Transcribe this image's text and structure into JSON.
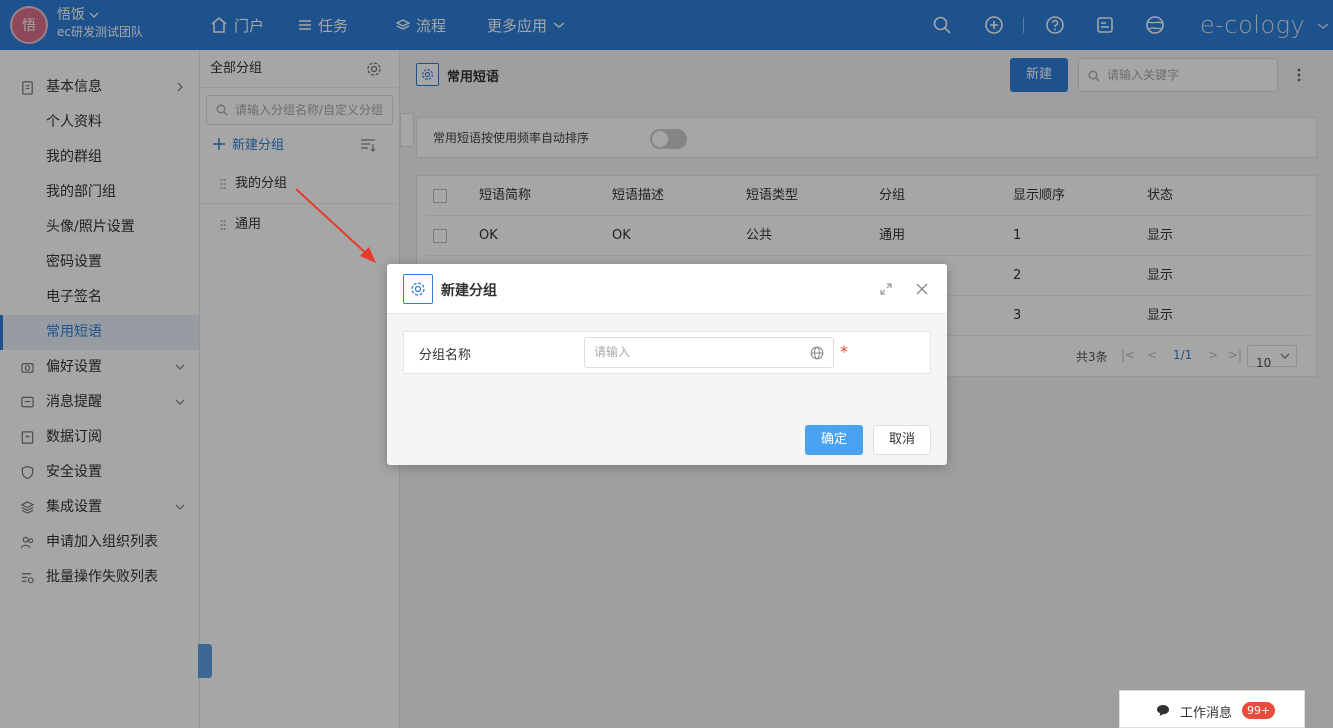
{
  "header": {
    "avatar_char": "悟",
    "user_name": "悟饭",
    "team": "ec研发测试团队",
    "nav": [
      "门户",
      "任务",
      "流程",
      "更多应用"
    ],
    "brand": "e-cology"
  },
  "sidebar": {
    "items": [
      {
        "label": "基本信息",
        "icon": "clipboard-icon",
        "arrow": "right"
      },
      {
        "label": "个人资料"
      },
      {
        "label": "我的群组"
      },
      {
        "label": "我的部门组"
      },
      {
        "label": "头像/照片设置"
      },
      {
        "label": "密码设置"
      },
      {
        "label": "电子签名"
      },
      {
        "label": "常用短语",
        "active": true
      },
      {
        "label": "偏好设置",
        "icon": "camera-icon",
        "arrow": "down"
      },
      {
        "label": "消息提醒",
        "icon": "chat-icon",
        "arrow": "down"
      },
      {
        "label": "数据订阅",
        "icon": "subscribe-icon"
      },
      {
        "label": "安全设置",
        "icon": "shield-icon"
      },
      {
        "label": "集成设置",
        "icon": "layers-icon",
        "arrow": "down"
      },
      {
        "label": "申请加入组织列表",
        "icon": "users-icon"
      },
      {
        "label": "批量操作失败列表",
        "icon": "list-error-icon"
      }
    ]
  },
  "groups": {
    "title": "全部分组",
    "search_placeholder": "请输入分组名称/自定义分组",
    "new_label": "新建分组",
    "items": [
      "我的分组",
      "通用"
    ]
  },
  "main": {
    "title": "常用短语",
    "new_button": "新建",
    "search_placeholder": "请输入关键字",
    "auto_sort_label": "常用短语按使用频率自动排序",
    "table": {
      "headers": [
        "短语简称",
        "短语描述",
        "短语类型",
        "分组",
        "显示顺序",
        "状态"
      ],
      "rows": [
        [
          "OK",
          "OK",
          "公共",
          "通用",
          "1",
          "显示"
        ],
        [
          "",
          "",
          "",
          "",
          "2",
          "显示"
        ],
        [
          "",
          "",
          "",
          "",
          "3",
          "显示"
        ]
      ]
    },
    "pager": {
      "total": "共3条",
      "page": "1/1",
      "size": "10"
    }
  },
  "dialog": {
    "title": "新建分组",
    "field_label": "分组名称",
    "input_placeholder": "请输入",
    "ok": "确定",
    "cancel": "取消"
  },
  "footer": {
    "work_msg": "工作消息",
    "badge": "99+"
  },
  "colors": {
    "primary": "#2f7ed8",
    "required": "#e94c3c"
  }
}
